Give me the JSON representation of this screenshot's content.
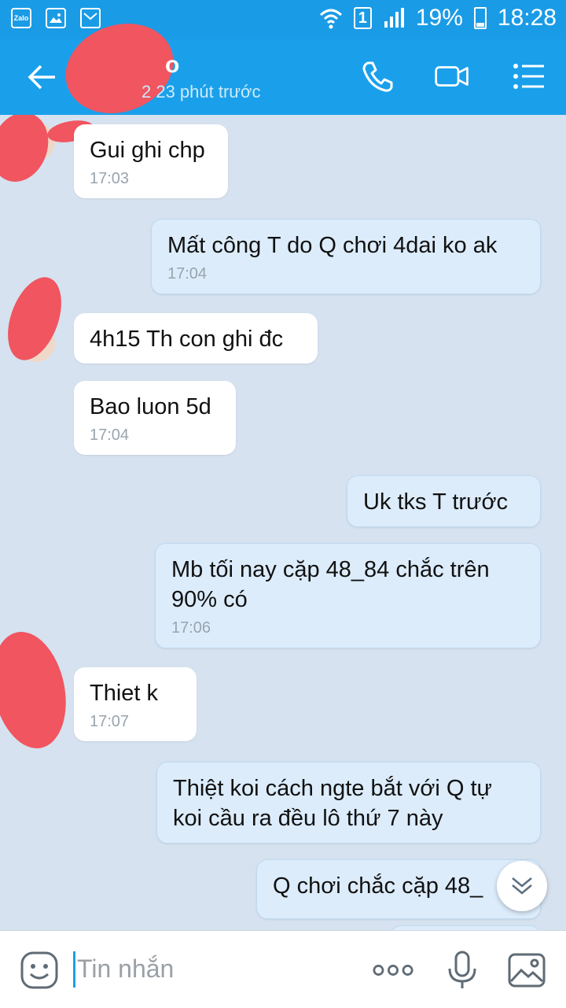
{
  "status_bar": {
    "sim": "1",
    "battery": "19%",
    "time": "18:28",
    "left_icons": [
      "zalo-icon",
      "image-icon",
      "gmail-icon"
    ],
    "zalo_text": "Zalo"
  },
  "header": {
    "name_visible": "o",
    "status": "2 23 phút trước"
  },
  "messages": [
    {
      "side": "in",
      "text": "Gui ghi chp",
      "time": "17:03"
    },
    {
      "side": "out",
      "text": "Mất công T do Q chơi 4dai ko ak",
      "time": "17:04"
    },
    {
      "side": "in",
      "text": "4h15 Th con ghi đc",
      "time": ""
    },
    {
      "side": "in",
      "text": "Bao luon 5d",
      "time": "17:04"
    },
    {
      "side": "out",
      "text": "Uk tks T trước",
      "time": ""
    },
    {
      "side": "out",
      "text": "Mb tối nay cặp 48_84 chắc trên 90% có",
      "time": "17:06"
    },
    {
      "side": "in",
      "text": "Thiet k",
      "time": "17:07"
    },
    {
      "side": "out",
      "text": "Thiệt koi cách ngte bắt với Q tự koi cầu ra đều lô thứ 7 này",
      "time": ""
    },
    {
      "side": "out",
      "text": "Q chơi chắc cặp 48_",
      "time": ""
    }
  ],
  "input": {
    "placeholder": "Tin nhắn"
  },
  "colors": {
    "header": "#1aa0eb",
    "status_bar": "#1a9be6",
    "chat_bg": "#d6e2ef",
    "incoming": "#ffffff",
    "outgoing": "#dcecfb",
    "redaction": "#f05560"
  }
}
